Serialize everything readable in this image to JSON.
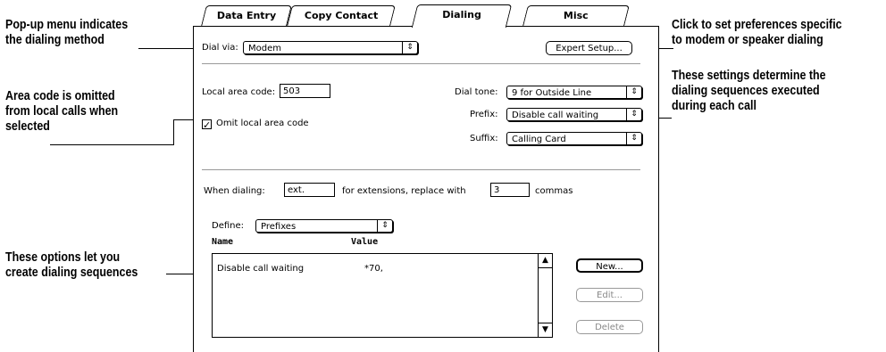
{
  "annotations": {
    "popup_method": [
      "Pop-up menu indicates",
      "the dialing method"
    ],
    "area_code": [
      "Area code is omitted",
      "from local calls when",
      "selected"
    ],
    "options": [
      "These options let you",
      "create dialing sequences"
    ],
    "expert": [
      "Click to set preferences specific",
      "to modem or speaker dialing"
    ],
    "settings": [
      "These settings determine the",
      "dialing sequences executed",
      "during each call"
    ]
  },
  "tabs": [
    "Data Entry",
    "Copy Contact",
    "Dialing",
    "Misc"
  ],
  "dial_via": {
    "label": "Dial via:",
    "value": "Modem"
  },
  "expert_setup": "Expert Setup...",
  "local_area_code": {
    "label": "Local area code:",
    "value": "503"
  },
  "omit": {
    "label": "Omit local area code",
    "checked": true,
    "mark": "✓"
  },
  "dial_tone": {
    "label": "Dial tone:",
    "value": "9 for Outside Line"
  },
  "prefix": {
    "label": "Prefix:",
    "value": "Disable call waiting"
  },
  "suffix": {
    "label": "Suffix:",
    "value": "Calling Card"
  },
  "when_dialing": {
    "label": "When dialing:",
    "ext_value": "ext.",
    "mid": "for extensions, replace with",
    "count": "3",
    "tail": "commas"
  },
  "define": {
    "label": "Define:",
    "value": "Prefixes"
  },
  "columns": {
    "name": "Name",
    "value": "Value"
  },
  "rows": [
    {
      "name": "Disable call waiting",
      "value": "*70,"
    }
  ],
  "buttons": {
    "new": "New...",
    "edit": "Edit...",
    "delete": "Delete"
  },
  "icons": {
    "popup_arrow": "⇕",
    "scroll_up": "▲",
    "scroll_down": "▼"
  }
}
